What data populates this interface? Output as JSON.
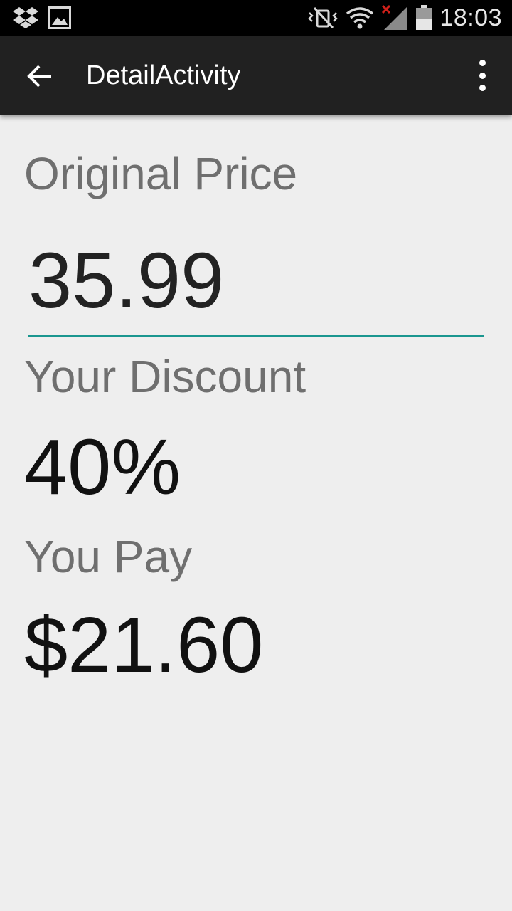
{
  "status_bar": {
    "time": "18:03",
    "left_icons": [
      "dropbox-icon",
      "image-icon"
    ],
    "right_icons": [
      "vibrate-mute-icon",
      "wifi-icon",
      "signal-no-service-icon",
      "battery-icon"
    ]
  },
  "app_bar": {
    "title": "DetailActivity",
    "back_icon": "arrow-back-icon",
    "overflow_icon": "more-vert-icon"
  },
  "content": {
    "original_price_label": "Original Price",
    "original_price_value": "35.99",
    "discount_label": "Your Discount",
    "discount_value": "40%",
    "you_pay_label": "You Pay",
    "you_pay_value": "$21.60"
  },
  "colors": {
    "accent": "#1a968f",
    "app_bar": "#212121",
    "background": "#eeeeee"
  }
}
